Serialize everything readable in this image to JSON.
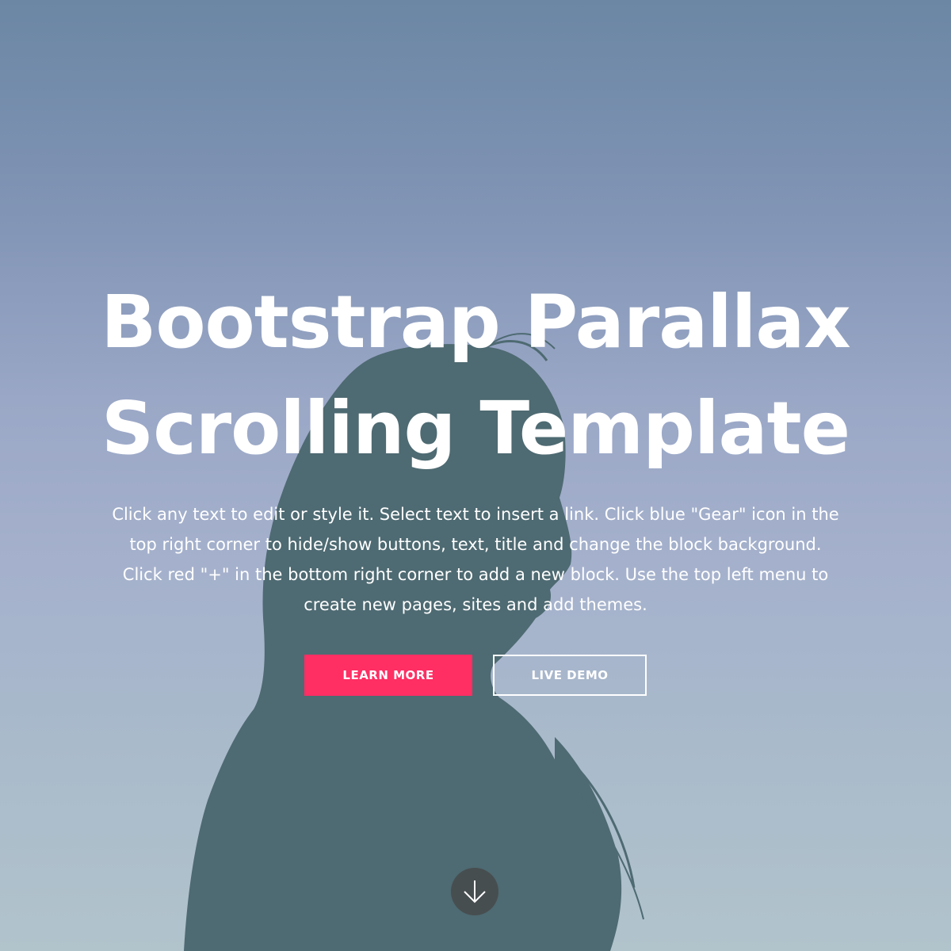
{
  "hero": {
    "title_line1": "Bootstrap Parallax",
    "title_line2": "Scrolling Template",
    "text": "Click any text to edit or style it. Select text to insert a link. Click blue \"Gear\" icon in the top right corner to hide/show buttons, text, title and change the block background. Click red \"+\" in the bottom right corner to add a new block. Use the top left menu to create new pages, sites and add themes.",
    "buttons": {
      "learn_more": "LEARN MORE",
      "live_demo": "LIVE DEMO"
    },
    "scroll_icon": "arrow-down-icon",
    "colors": {
      "primary_button": "#ff2e63",
      "silhouette": "#4e6a72",
      "sky_top": "#6b87a4",
      "sky_bottom": "#b1c3cb"
    }
  }
}
